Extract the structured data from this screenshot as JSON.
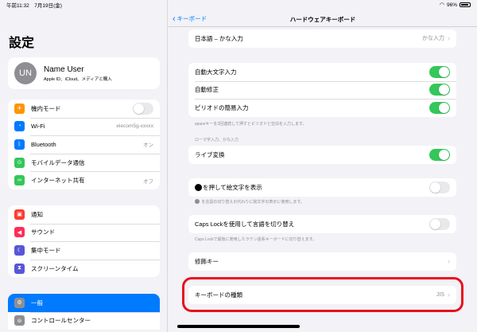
{
  "status": {
    "time_date": "午前11:32　7月19日(金)",
    "battery": "96%"
  },
  "sidebar": {
    "title": "設定",
    "profile": {
      "initials": "UN",
      "name": "Name User",
      "subtitle": "Apple ID、iCloud、メディアと購入"
    },
    "group1": [
      {
        "label": "機内モード",
        "icon": "airplane-icon",
        "color": "#ff9500",
        "glyph": "✈",
        "toggle": false
      },
      {
        "label": "Wi-Fi",
        "icon": "wifi-icon",
        "color": "#007aff",
        "glyph": "◔",
        "value": "elecom5g-xxxxx"
      },
      {
        "label": "Bluetooth",
        "icon": "bluetooth-icon",
        "color": "#007aff",
        "glyph": "ᛒ",
        "value": "オン"
      },
      {
        "label": "モバイルデータ通信",
        "icon": "cellular-icon",
        "color": "#34c759",
        "glyph": "⊙"
      },
      {
        "label": "インターネット共有",
        "icon": "hotspot-icon",
        "color": "#34c759",
        "glyph": "∞",
        "value": "オフ"
      }
    ],
    "group2": [
      {
        "label": "通知",
        "icon": "notifications-icon",
        "color": "#ff3b30",
        "glyph": "▣"
      },
      {
        "label": "サウンド",
        "icon": "sound-icon",
        "color": "#ff2d55",
        "glyph": "◀"
      },
      {
        "label": "集中モード",
        "icon": "focus-moon-icon",
        "color": "#5856d6",
        "glyph": "☾"
      },
      {
        "label": "スクリーンタイム",
        "icon": "screen-time-icon",
        "color": "#5856d6",
        "glyph": "⧗"
      }
    ],
    "group3": [
      {
        "label": "一般",
        "icon": "gear-icon",
        "color": "#8e8e93",
        "glyph": "⚙",
        "selected": true
      },
      {
        "label": "コントロールセンター",
        "icon": "control-center-icon",
        "color": "#8e8e93",
        "glyph": "⊜"
      }
    ]
  },
  "nav": {
    "back_label": "キーボード",
    "title": "ハードウェアキーボード"
  },
  "main": {
    "japanese_kana": {
      "label": "日本語 – かな入力",
      "value": "かな入力"
    },
    "auto_group": [
      {
        "label": "自動大文字入力",
        "on": true
      },
      {
        "label": "自動修正",
        "on": true
      },
      {
        "label": "ピリオドの簡易入力",
        "on": true
      }
    ],
    "period_footer": "spaceキーを2回連続して押すとピリオドと空白を入力します。",
    "romaji_header": "ローマ字入力、かな入力",
    "live_conversion": {
      "label": "ライブ変換",
      "on": true
    },
    "globe_emoji": {
      "label": "を押して絵文字を表示",
      "on": false
    },
    "globe_footer": "を言語の切り替えの代わりに絵文字の表示に使用します。",
    "caps_lock": {
      "label": "Caps Lockを使用して言語を切り替え",
      "on": false
    },
    "caps_footer": "Caps Lockで最後に使用したラテン語系キーボードに切り替えます。",
    "modifier_keys": {
      "label": "修飾キー"
    },
    "keyboard_type": {
      "label": "キーボードの種類",
      "value": "JIS"
    }
  }
}
